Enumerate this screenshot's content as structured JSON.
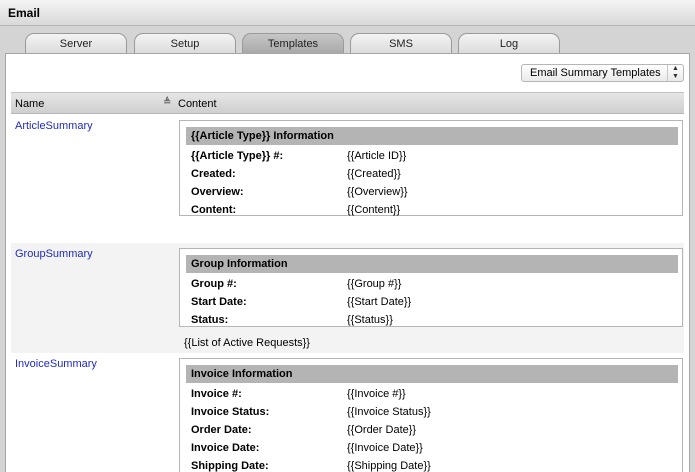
{
  "window": {
    "title": "Email"
  },
  "tabs": [
    {
      "label": "Server"
    },
    {
      "label": "Setup"
    },
    {
      "label": "Templates"
    },
    {
      "label": "SMS"
    },
    {
      "label": "Log"
    }
  ],
  "toolbar": {
    "template_select": "Email Summary Templates"
  },
  "table": {
    "headers": {
      "name": "Name",
      "content": "Content"
    }
  },
  "templates": [
    {
      "name": "ArticleSummary",
      "heading": "{{Article Type}} Information",
      "fields": [
        {
          "key": "{{Article Type}} #:",
          "value": "{{Article ID}}"
        },
        {
          "key": "Created:",
          "value": "{{Created}}"
        },
        {
          "key": "Overview:",
          "value": "{{Overview}}"
        },
        {
          "key": "Content:",
          "value": "{{Content}}"
        }
      ]
    },
    {
      "name": "GroupSummary",
      "heading": "Group Information",
      "fields": [
        {
          "key": "Group #:",
          "value": "{{Group #}}"
        },
        {
          "key": "Start Date:",
          "value": "{{Start Date}}"
        },
        {
          "key": "Status:",
          "value": "{{Status}}"
        }
      ],
      "extra": "{{List of Active Requests}}"
    },
    {
      "name": "InvoiceSummary",
      "heading": "Invoice Information",
      "fields": [
        {
          "key": "Invoice #:",
          "value": "{{Invoice #}}"
        },
        {
          "key": "Invoice Status:",
          "value": "{{Invoice Status}}"
        },
        {
          "key": "Order Date:",
          "value": "{{Order Date}}"
        },
        {
          "key": "Invoice Date:",
          "value": "{{Invoice Date}}"
        },
        {
          "key": "Shipping Date:",
          "value": "{{Shipping Date}}"
        }
      ]
    }
  ]
}
